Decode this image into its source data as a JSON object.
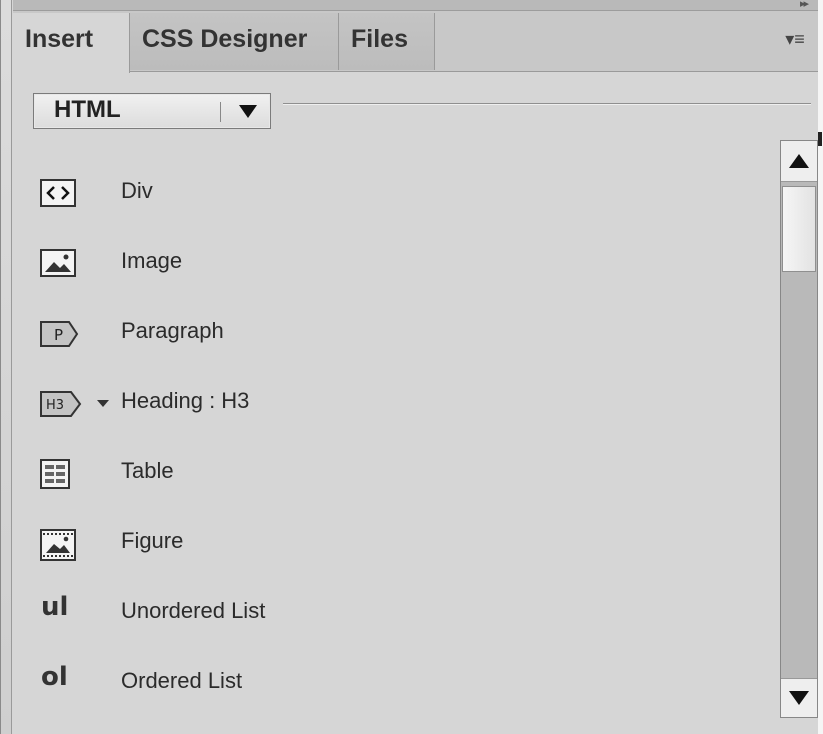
{
  "tabs": [
    {
      "label": "Insert",
      "active": true
    },
    {
      "label": "CSS Designer",
      "active": false
    },
    {
      "label": "Files",
      "active": false
    }
  ],
  "category_select": {
    "value": "HTML"
  },
  "items": [
    {
      "label": "Div",
      "icon": "div-tag-icon"
    },
    {
      "label": "Image",
      "icon": "image-icon"
    },
    {
      "label": "Paragraph",
      "icon": "paragraph-tag-icon"
    },
    {
      "label": "Heading : H3",
      "icon": "heading-h3-tag-icon",
      "has_dropdown": true
    },
    {
      "label": "Table",
      "icon": "table-icon"
    },
    {
      "label": "Figure",
      "icon": "figure-icon"
    },
    {
      "label": "Unordered List",
      "icon_text": "ul"
    },
    {
      "label": "Ordered List",
      "icon_text": "ol"
    }
  ],
  "icon_tags": {
    "paragraph": "P",
    "heading": "H3"
  },
  "colors": {
    "panel": "#d6d6d6",
    "tab_strip": "#c8c8c8",
    "text": "#2b2b2b"
  }
}
